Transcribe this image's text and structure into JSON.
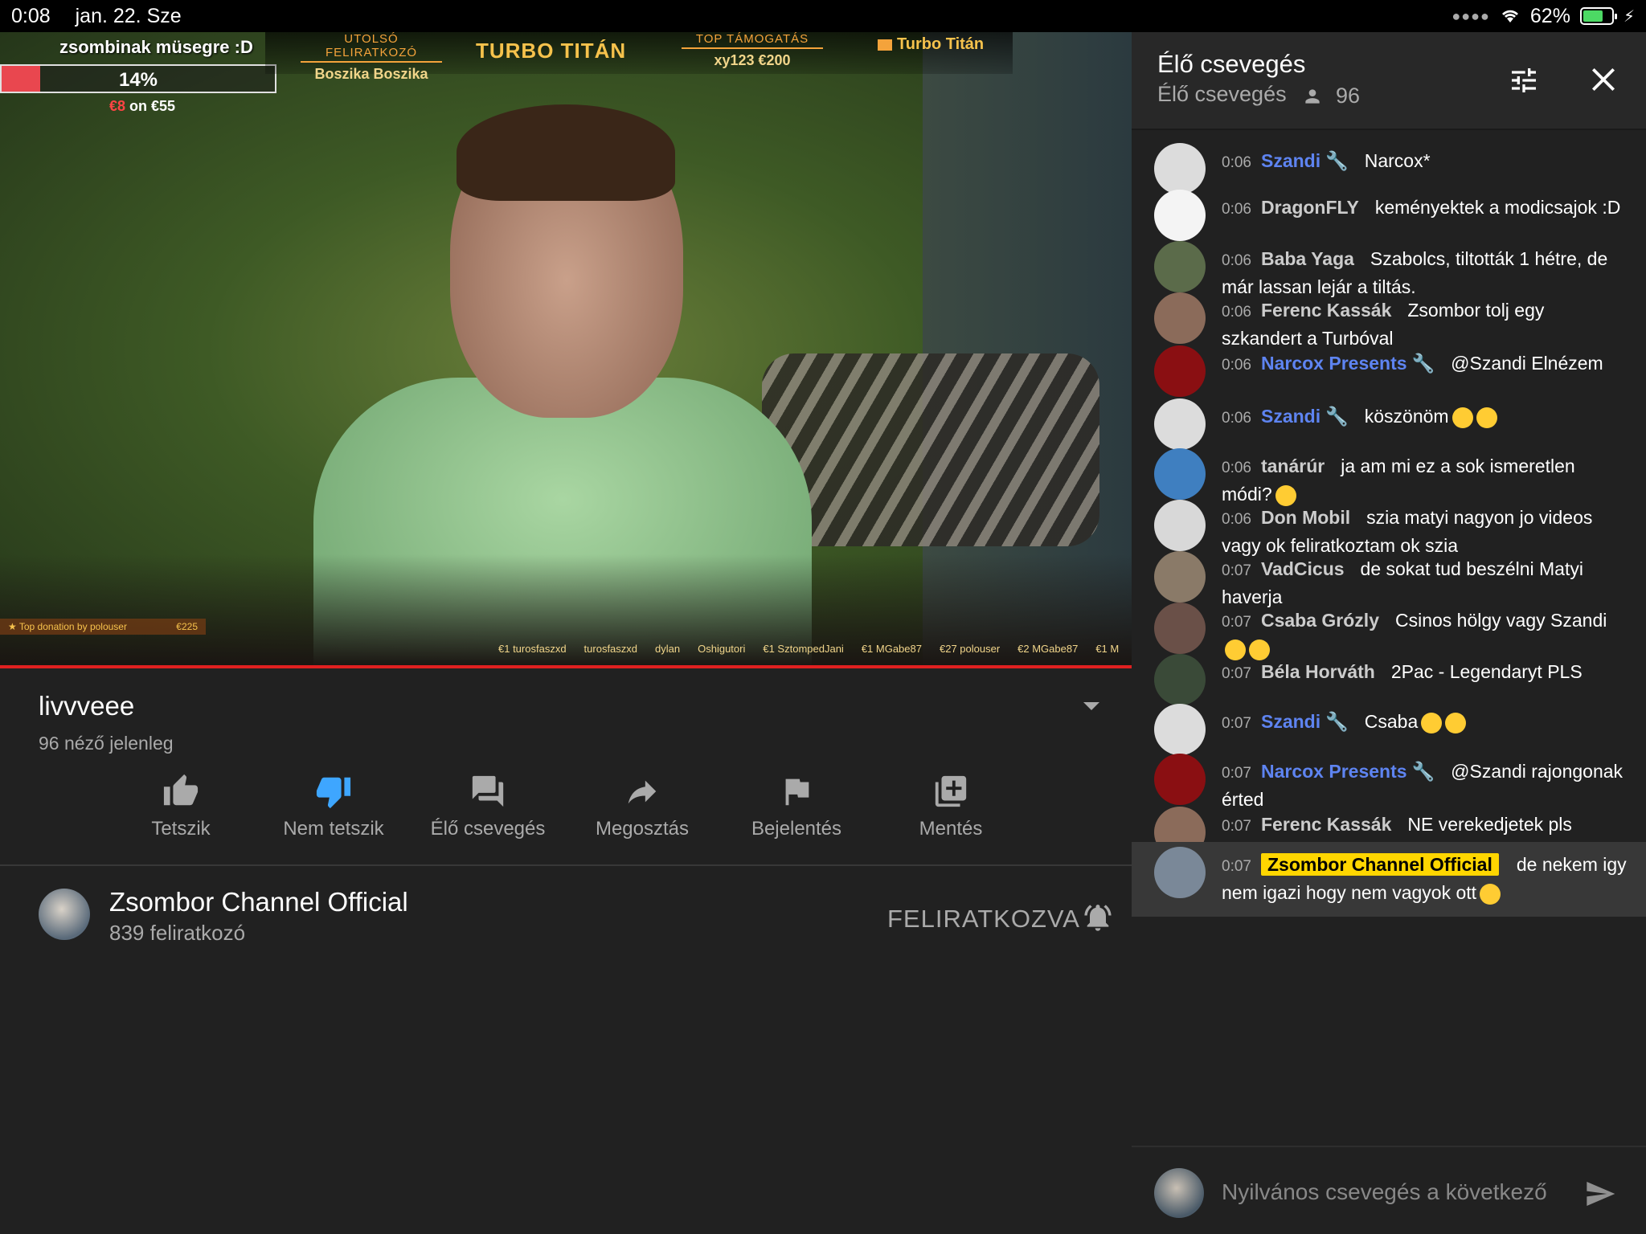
{
  "status": {
    "time": "0:08",
    "date": "jan. 22. Sze",
    "battery": "62%",
    "battery_level": 0.62
  },
  "overlay": {
    "goal_title": "zsombinak müsegre :D",
    "goal_percent_label": "14%",
    "goal_level": 0.14,
    "goal_amount_raised": "€8",
    "goal_amount_rest": "on €55",
    "last_sub_label": "UTOLSÓ FELIRATKOZÓ",
    "last_sub_value": "Boszika Boszika",
    "center_title": "TURBO TITÁN",
    "top_support_label": "TOP TÁMOGATÁS",
    "top_support_value": "xy123 €200",
    "right_title": "Turbo Titán",
    "top_donation": "Top donation by polouser",
    "top_donation_amount": "€225",
    "ticker": [
      "€1 turosfaszxd",
      "turosfaszxd",
      "dylan",
      "Oshigutori",
      "€1 SztompedJani",
      "€1 MGabe87",
      "€27 polouser",
      "€2 MGabe87",
      "€1 M"
    ]
  },
  "video": {
    "title": "livvveee",
    "viewers": "96 néző jelenleg",
    "actions": {
      "like": "Tetszik",
      "dislike": "Nem tetszik",
      "chat": "Élő csevegés",
      "share": "Megosztás",
      "report": "Bejelentés",
      "save": "Mentés"
    },
    "channel_name": "Zsombor Channel Official",
    "channel_subs": "839 feliratkozó",
    "subscribed_label": "FELIRATKOZVA",
    "accent": "#3ea6ff"
  },
  "chat": {
    "title": "Élő csevegés",
    "subtitle": "Élő csevegés",
    "viewer_count": "96",
    "input_placeholder": "Nyilvános csevegés a következő",
    "messages": [
      {
        "time": "0:06",
        "author": "Szandi",
        "text": "Narcox*"
      },
      {
        "time": "0:06",
        "author": "DragonFLY",
        "text": "keményektek a modicsajok :D"
      },
      {
        "time": "0:06",
        "author": "Baba Yaga",
        "text": "Szabolcs, tiltották 1 hétre, de már lassan lejár a tiltás."
      },
      {
        "time": "0:06",
        "author": "Ferenc Kassák",
        "text": "Zsombor tolj egy szkandert a Turbóval"
      },
      {
        "time": "0:06",
        "author": "Narcox Presents",
        "text": "@Szandi Elnézem"
      },
      {
        "time": "0:06",
        "author": "Szandi",
        "text": "köszönöm"
      },
      {
        "time": "0:06",
        "author": "tanárúr",
        "text": "ja am mi ez a sok ismeretlen módi?"
      },
      {
        "time": "0:06",
        "author": "Don Mobil",
        "text": "szia matyi nagyon jo videos vagy ok feliratkoztam ok szia"
      },
      {
        "time": "0:07",
        "author": "VadCicus",
        "text": "de sokat tud beszélni Matyi haverja"
      },
      {
        "time": "0:07",
        "author": "Csaba Grózly",
        "text": "Csinos hölgy vagy Szandi"
      },
      {
        "time": "0:07",
        "author": "Béla Horváth",
        "text": "2Pac - Legendaryt PLS"
      },
      {
        "time": "0:07",
        "author": "Szandi",
        "text": "Csaba"
      },
      {
        "time": "0:07",
        "author": "Narcox Presents",
        "text": "@Szandi rajongonak érted"
      },
      {
        "time": "0:07",
        "author": "Ferenc Kassák",
        "text": "NE verekedjetek pls"
      },
      {
        "time": "0:07",
        "author": "Zsombor Channel Official",
        "text": "de nekem igy nem igazi hogy nem vagyok ott"
      }
    ]
  }
}
